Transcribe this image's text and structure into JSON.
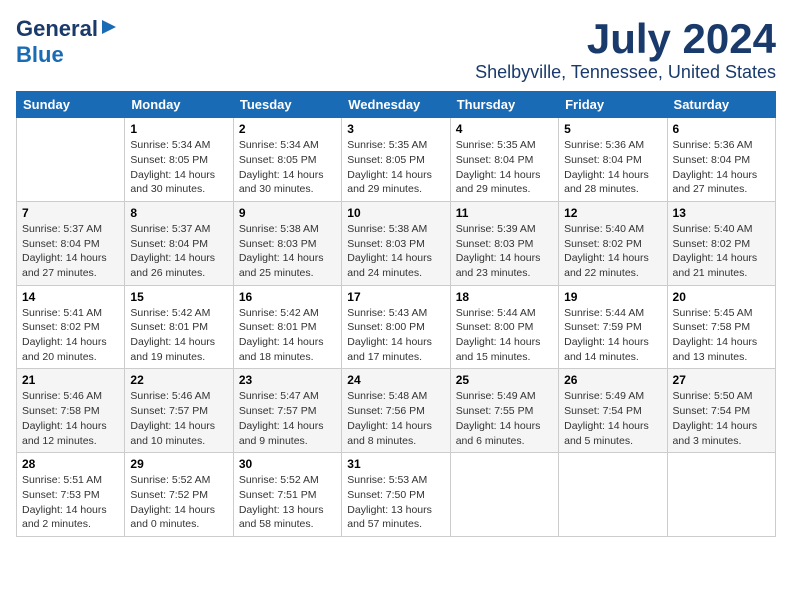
{
  "logo": {
    "line1": "General",
    "line2": "Blue",
    "arrow": "►"
  },
  "title": {
    "month": "July 2024",
    "location": "Shelbyville, Tennessee, United States"
  },
  "weekdays": [
    "Sunday",
    "Monday",
    "Tuesday",
    "Wednesday",
    "Thursday",
    "Friday",
    "Saturday"
  ],
  "weeks": [
    [
      {
        "day": "",
        "info": ""
      },
      {
        "day": "1",
        "info": "Sunrise: 5:34 AM\nSunset: 8:05 PM\nDaylight: 14 hours\nand 30 minutes."
      },
      {
        "day": "2",
        "info": "Sunrise: 5:34 AM\nSunset: 8:05 PM\nDaylight: 14 hours\nand 30 minutes."
      },
      {
        "day": "3",
        "info": "Sunrise: 5:35 AM\nSunset: 8:05 PM\nDaylight: 14 hours\nand 29 minutes."
      },
      {
        "day": "4",
        "info": "Sunrise: 5:35 AM\nSunset: 8:04 PM\nDaylight: 14 hours\nand 29 minutes."
      },
      {
        "day": "5",
        "info": "Sunrise: 5:36 AM\nSunset: 8:04 PM\nDaylight: 14 hours\nand 28 minutes."
      },
      {
        "day": "6",
        "info": "Sunrise: 5:36 AM\nSunset: 8:04 PM\nDaylight: 14 hours\nand 27 minutes."
      }
    ],
    [
      {
        "day": "7",
        "info": "Sunrise: 5:37 AM\nSunset: 8:04 PM\nDaylight: 14 hours\nand 27 minutes."
      },
      {
        "day": "8",
        "info": "Sunrise: 5:37 AM\nSunset: 8:04 PM\nDaylight: 14 hours\nand 26 minutes."
      },
      {
        "day": "9",
        "info": "Sunrise: 5:38 AM\nSunset: 8:03 PM\nDaylight: 14 hours\nand 25 minutes."
      },
      {
        "day": "10",
        "info": "Sunrise: 5:38 AM\nSunset: 8:03 PM\nDaylight: 14 hours\nand 24 minutes."
      },
      {
        "day": "11",
        "info": "Sunrise: 5:39 AM\nSunset: 8:03 PM\nDaylight: 14 hours\nand 23 minutes."
      },
      {
        "day": "12",
        "info": "Sunrise: 5:40 AM\nSunset: 8:02 PM\nDaylight: 14 hours\nand 22 minutes."
      },
      {
        "day": "13",
        "info": "Sunrise: 5:40 AM\nSunset: 8:02 PM\nDaylight: 14 hours\nand 21 minutes."
      }
    ],
    [
      {
        "day": "14",
        "info": "Sunrise: 5:41 AM\nSunset: 8:02 PM\nDaylight: 14 hours\nand 20 minutes."
      },
      {
        "day": "15",
        "info": "Sunrise: 5:42 AM\nSunset: 8:01 PM\nDaylight: 14 hours\nand 19 minutes."
      },
      {
        "day": "16",
        "info": "Sunrise: 5:42 AM\nSunset: 8:01 PM\nDaylight: 14 hours\nand 18 minutes."
      },
      {
        "day": "17",
        "info": "Sunrise: 5:43 AM\nSunset: 8:00 PM\nDaylight: 14 hours\nand 17 minutes."
      },
      {
        "day": "18",
        "info": "Sunrise: 5:44 AM\nSunset: 8:00 PM\nDaylight: 14 hours\nand 15 minutes."
      },
      {
        "day": "19",
        "info": "Sunrise: 5:44 AM\nSunset: 7:59 PM\nDaylight: 14 hours\nand 14 minutes."
      },
      {
        "day": "20",
        "info": "Sunrise: 5:45 AM\nSunset: 7:58 PM\nDaylight: 14 hours\nand 13 minutes."
      }
    ],
    [
      {
        "day": "21",
        "info": "Sunrise: 5:46 AM\nSunset: 7:58 PM\nDaylight: 14 hours\nand 12 minutes."
      },
      {
        "day": "22",
        "info": "Sunrise: 5:46 AM\nSunset: 7:57 PM\nDaylight: 14 hours\nand 10 minutes."
      },
      {
        "day": "23",
        "info": "Sunrise: 5:47 AM\nSunset: 7:57 PM\nDaylight: 14 hours\nand 9 minutes."
      },
      {
        "day": "24",
        "info": "Sunrise: 5:48 AM\nSunset: 7:56 PM\nDaylight: 14 hours\nand 8 minutes."
      },
      {
        "day": "25",
        "info": "Sunrise: 5:49 AM\nSunset: 7:55 PM\nDaylight: 14 hours\nand 6 minutes."
      },
      {
        "day": "26",
        "info": "Sunrise: 5:49 AM\nSunset: 7:54 PM\nDaylight: 14 hours\nand 5 minutes."
      },
      {
        "day": "27",
        "info": "Sunrise: 5:50 AM\nSunset: 7:54 PM\nDaylight: 14 hours\nand 3 minutes."
      }
    ],
    [
      {
        "day": "28",
        "info": "Sunrise: 5:51 AM\nSunset: 7:53 PM\nDaylight: 14 hours\nand 2 minutes."
      },
      {
        "day": "29",
        "info": "Sunrise: 5:52 AM\nSunset: 7:52 PM\nDaylight: 14 hours\nand 0 minutes."
      },
      {
        "day": "30",
        "info": "Sunrise: 5:52 AM\nSunset: 7:51 PM\nDaylight: 13 hours\nand 58 minutes."
      },
      {
        "day": "31",
        "info": "Sunrise: 5:53 AM\nSunset: 7:50 PM\nDaylight: 13 hours\nand 57 minutes."
      },
      {
        "day": "",
        "info": ""
      },
      {
        "day": "",
        "info": ""
      },
      {
        "day": "",
        "info": ""
      }
    ]
  ]
}
